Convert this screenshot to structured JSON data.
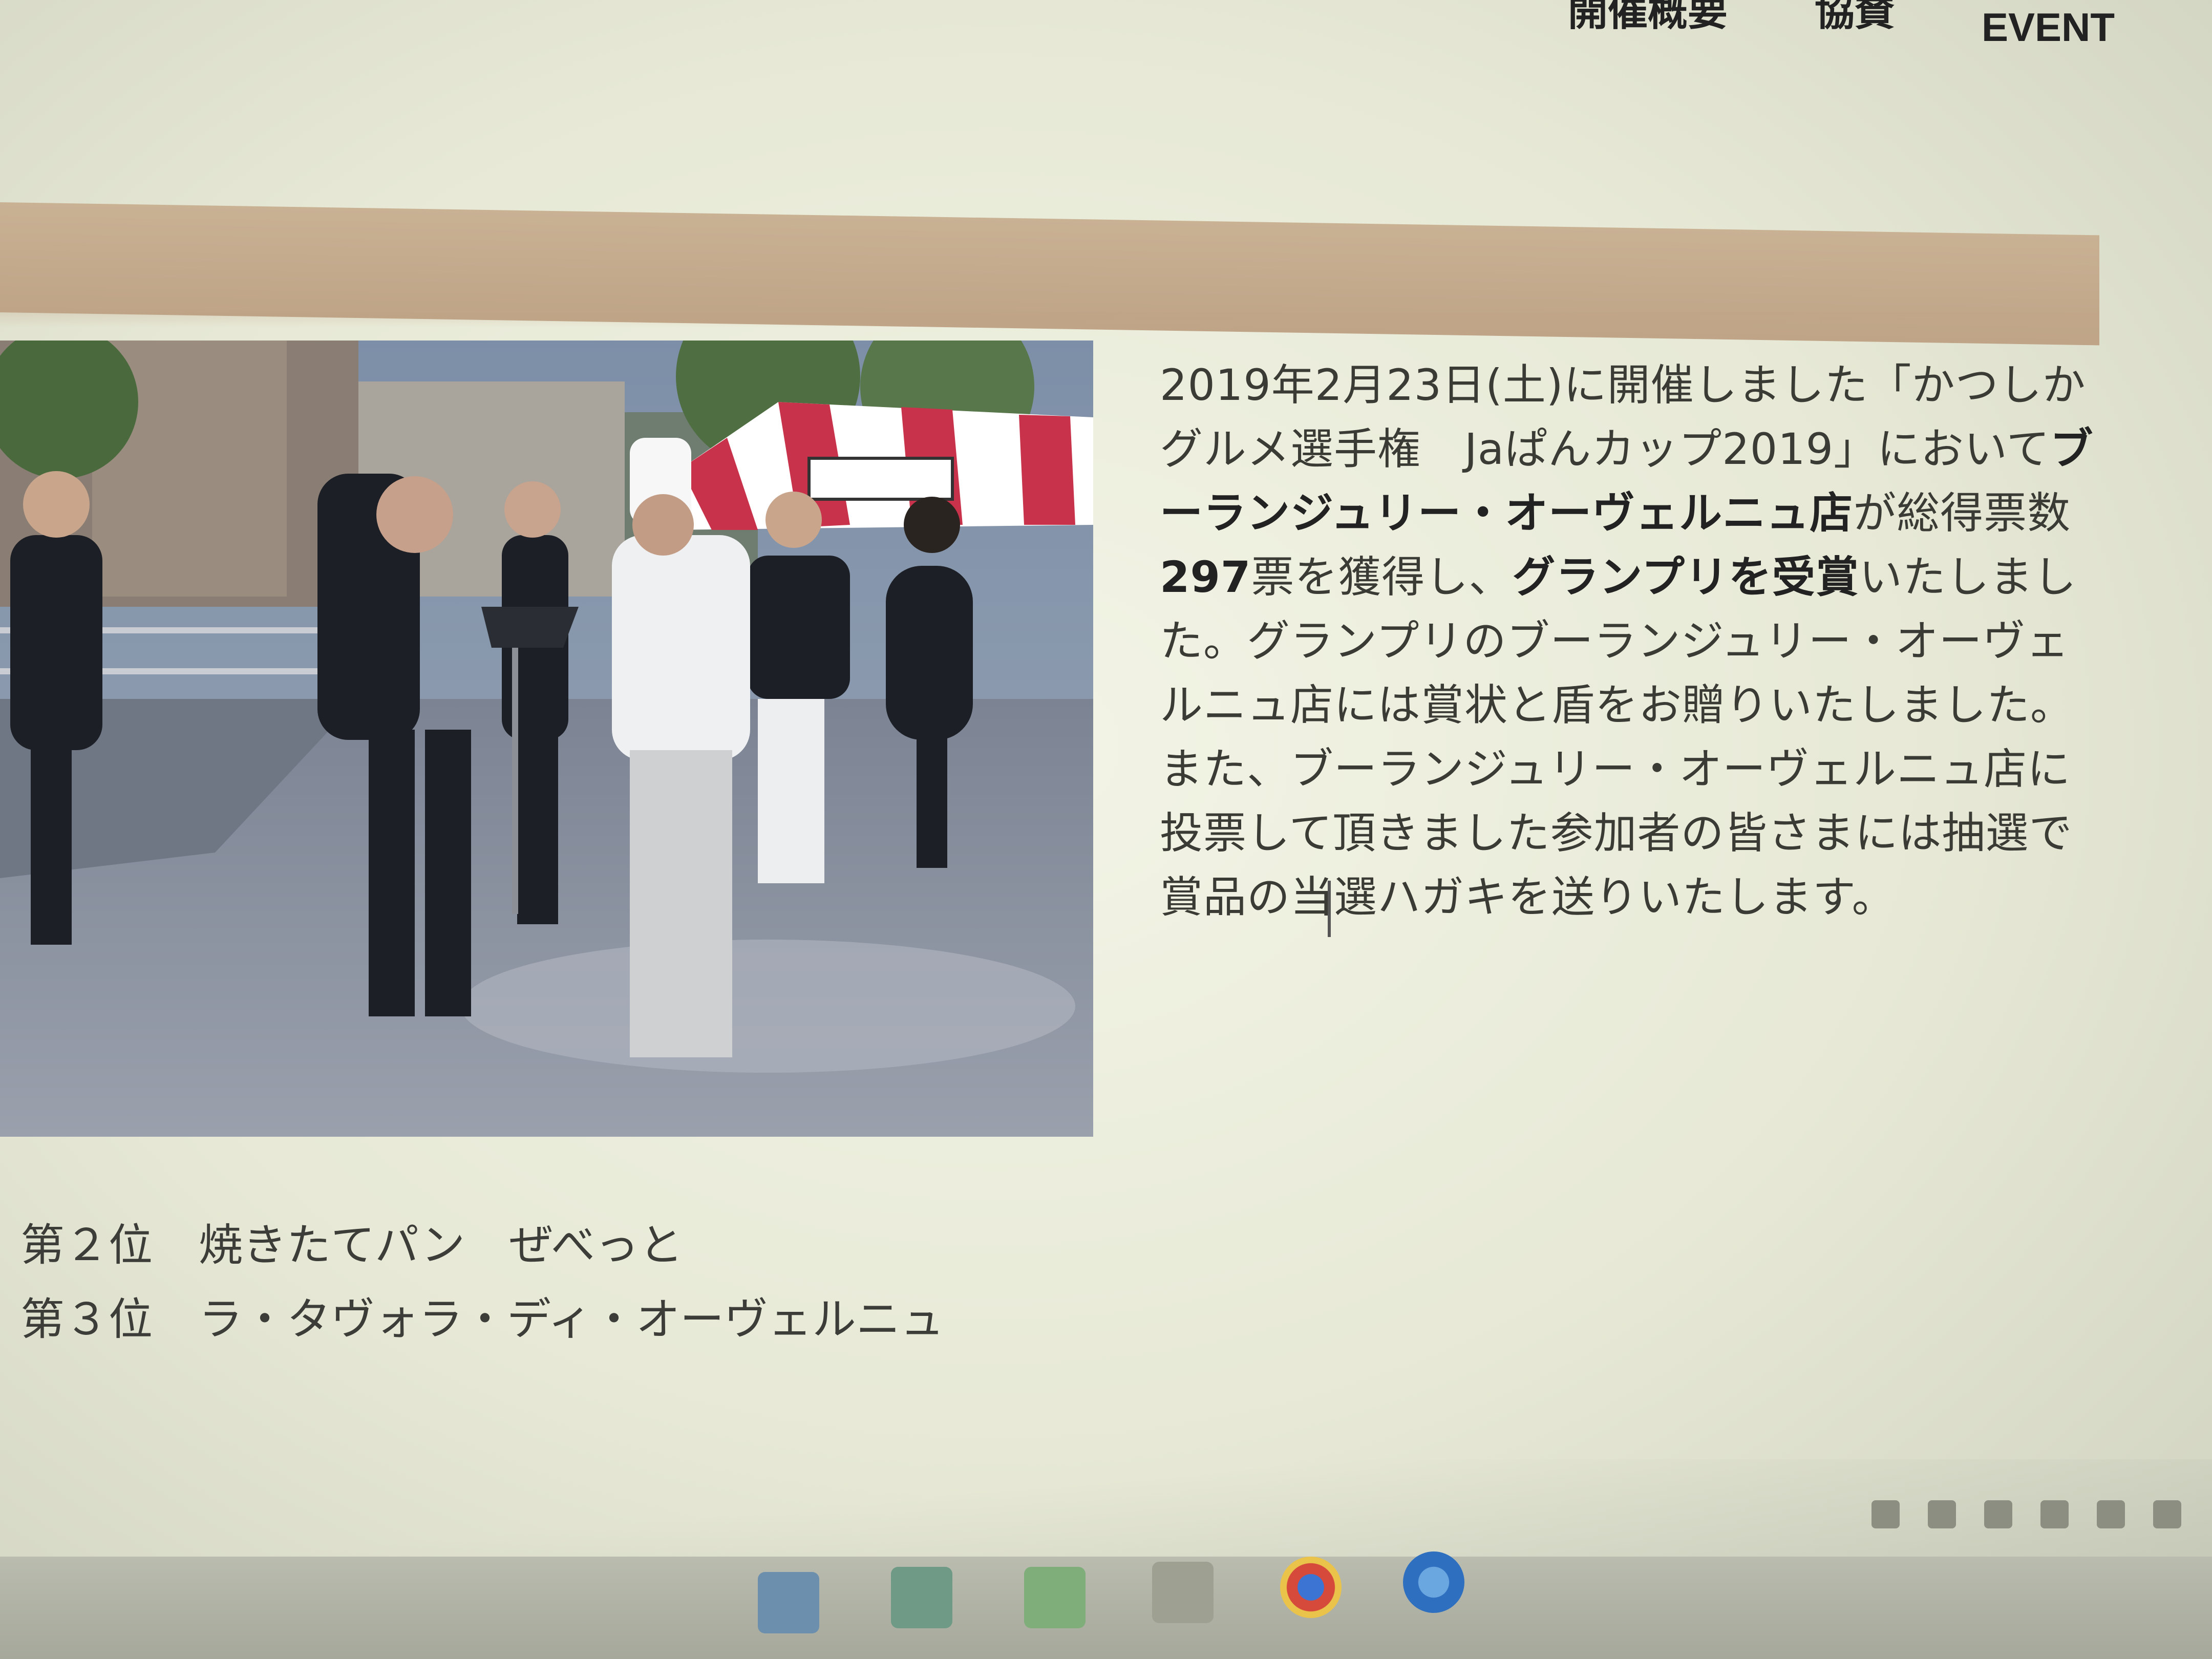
{
  "nav": {
    "items": [
      {
        "label": "開催概要"
      },
      {
        "label": "協賛"
      },
      {
        "label": "EVENT"
      }
    ]
  },
  "article": {
    "p1": "2019年2月23日(土)に開催しました「かつしかグルメ選手権　Jaぱんカップ2019」において",
    "store_bold": "ブーランジュリー・オーヴェルニュ店",
    "p2": "が総得票数",
    "votes_bold": "297",
    "p3": "票を獲得し、",
    "grandprix_bold": "グランプリを受賞",
    "p4": "いたしました。グランプリのブーランジュリー・オーヴェルニュ店には賞状と盾をお贈りいたしました。また、ブーランジュリー・オーヴェルニュ店に投票して頂きました参加者の皆さまには抽選で賞品の当選ハガキを送りいたします。"
  },
  "ranks": [
    {
      "place": "第２位",
      "name": "焼きたてパン　ぜべっと"
    },
    {
      "place": "第３位",
      "name": "ラ・タヴォラ・ディ・オーヴェルニュ"
    }
  ],
  "colors": {
    "band": "#c4aa8c",
    "tent_red": "#c8324a",
    "background": "#eef0e0"
  },
  "icons": {
    "photo": "award-ceremony-photo",
    "taskbar": [
      "file-explorer-icon",
      "store-icon",
      "mail-icon",
      "chrome-icon",
      "internet-explorer-icon"
    ]
  }
}
